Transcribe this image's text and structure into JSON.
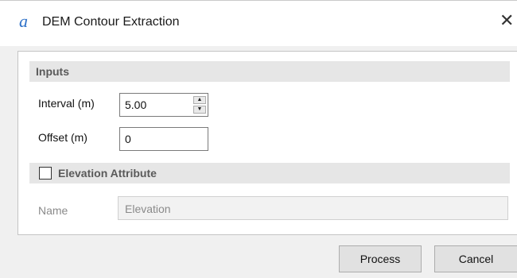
{
  "window": {
    "app_icon_glyph": "a",
    "title": "DEM Contour Extraction",
    "close_glyph": "✕"
  },
  "inputs": {
    "header": "Inputs",
    "interval": {
      "label": "Interval  (m)",
      "value": "5.00",
      "up_glyph": "▲",
      "down_glyph": "▼"
    },
    "offset": {
      "label": "Offset  (m)",
      "value": "0"
    }
  },
  "elevation_attribute": {
    "label": "Elevation Attribute",
    "checked": false,
    "name_label": "Name",
    "name_value": "Elevation"
  },
  "buttons": {
    "process": "Process",
    "cancel": "Cancel"
  },
  "colors": {
    "accent": "#2f72c9",
    "dialog_bg": "#f0f0f0",
    "section_bg": "#e6e6e6",
    "disabled_text": "#8a8a8a"
  }
}
